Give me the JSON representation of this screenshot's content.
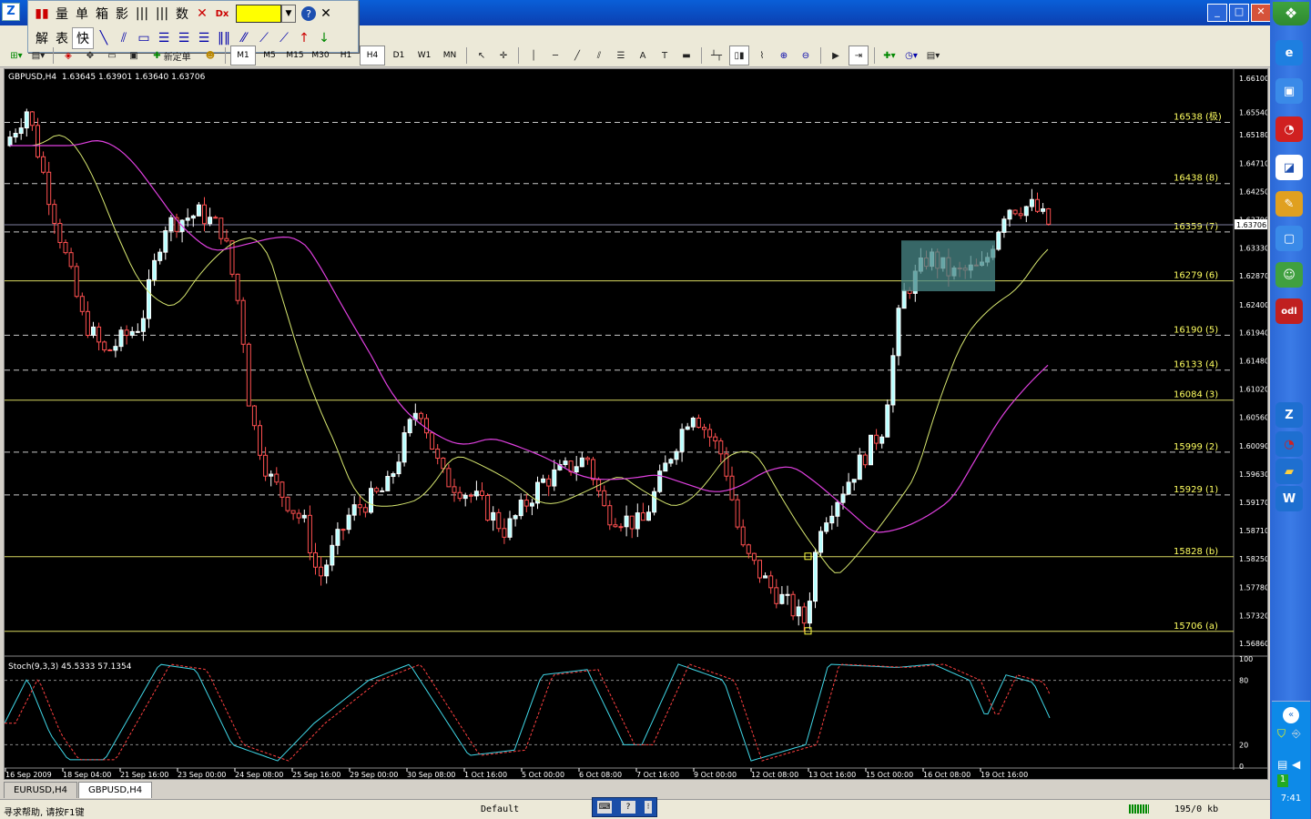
{
  "panel": {
    "row1": [
      "量",
      "单",
      "箱",
      "影",
      "数"
    ],
    "row2": [
      "解",
      "表",
      "快"
    ]
  },
  "toolbar": {
    "new_order": "新定单",
    "timeframes": [
      "M1",
      "M5",
      "M15",
      "M30",
      "H1",
      "H4",
      "D1",
      "W1",
      "MN"
    ],
    "active_timeframe": "H4"
  },
  "chart": {
    "header": "GBPUSD,H4  1.63645 1.63901 1.63640 1.63706",
    "stoch_header": "Stoch(9,3,3) 45.5333 57.1354",
    "current_price": "1.63706",
    "price_axis": [
      "1.66100",
      "1.65540",
      "1.65180",
      "1.64710",
      "1.64250",
      "1.63790",
      "1.63330",
      "1.62870",
      "1.62400",
      "1.61940",
      "1.61480",
      "1.61020",
      "1.60560",
      "1.60090",
      "1.59630",
      "1.59170",
      "1.58710",
      "1.58250",
      "1.57780",
      "1.57320",
      "1.56860"
    ],
    "stoch_axis": [
      "100",
      "80",
      "20",
      "0"
    ],
    "time_axis": [
      "16 Sep 2009",
      "18 Sep 04:00",
      "21 Sep 16:00",
      "23 Sep 00:00",
      "24 Sep 08:00",
      "25 Sep 16:00",
      "29 Sep 00:00",
      "30 Sep 08:00",
      "1 Oct 16:00",
      "5 Oct 00:00",
      "6 Oct 08:00",
      "7 Oct 16:00",
      "9 Oct 00:00",
      "12 Oct 08:00",
      "13 Oct 16:00",
      "15 Oct 00:00",
      "16 Oct 08:00",
      "19 Oct 16:00"
    ],
    "levels": [
      {
        "label": "16538 (极)",
        "price": 1.6538,
        "style": "dash",
        "color": "#c8c8c8"
      },
      {
        "label": "16438 (8)",
        "price": 1.6438,
        "style": "dash",
        "color": "#c8c8c8"
      },
      {
        "label": "16359 (7)",
        "price": 1.6359,
        "style": "dash",
        "color": "#c8c8c8"
      },
      {
        "label": "16279 (6)",
        "price": 1.6279,
        "style": "solid",
        "color": "#d8d860"
      },
      {
        "label": "16190 (5)",
        "price": 1.619,
        "style": "dash",
        "color": "#c8c8c8"
      },
      {
        "label": "16133 (4)",
        "price": 1.6133,
        "style": "dash",
        "color": "#c8c8c8"
      },
      {
        "label": "16084 (3)",
        "price": 1.6084,
        "style": "solid",
        "color": "#d8d860"
      },
      {
        "label": "15999 (2)",
        "price": 1.5999,
        "style": "dash",
        "color": "#c8c8c8"
      },
      {
        "label": "15929 (1)",
        "price": 1.5929,
        "style": "dash",
        "color": "#c8c8c8"
      },
      {
        "label": "15828 (b)",
        "price": 1.5828,
        "style": "solid",
        "color": "#d8d860"
      },
      {
        "label": "15706 (a)",
        "price": 1.5706,
        "style": "solid",
        "color": "#d8d860"
      }
    ],
    "colors": {
      "bull": "#ffffff",
      "bear": "#ff5050",
      "ma_fast": "#d8e870",
      "ma_slow": "#e040e0",
      "stoch_main": "#40d8e8",
      "stoch_signal": "#ff4040",
      "box": "#4a8a8a"
    }
  },
  "tabs": [
    "EURUSD,H4",
    "GBPUSD,H4"
  ],
  "active_tab": "GBPUSD,H4",
  "status": {
    "help": "寻求帮助, 请按F1键",
    "profile": "Default",
    "traffic": "195/0 kb"
  },
  "taskbar": {
    "clock": "7:41"
  }
}
